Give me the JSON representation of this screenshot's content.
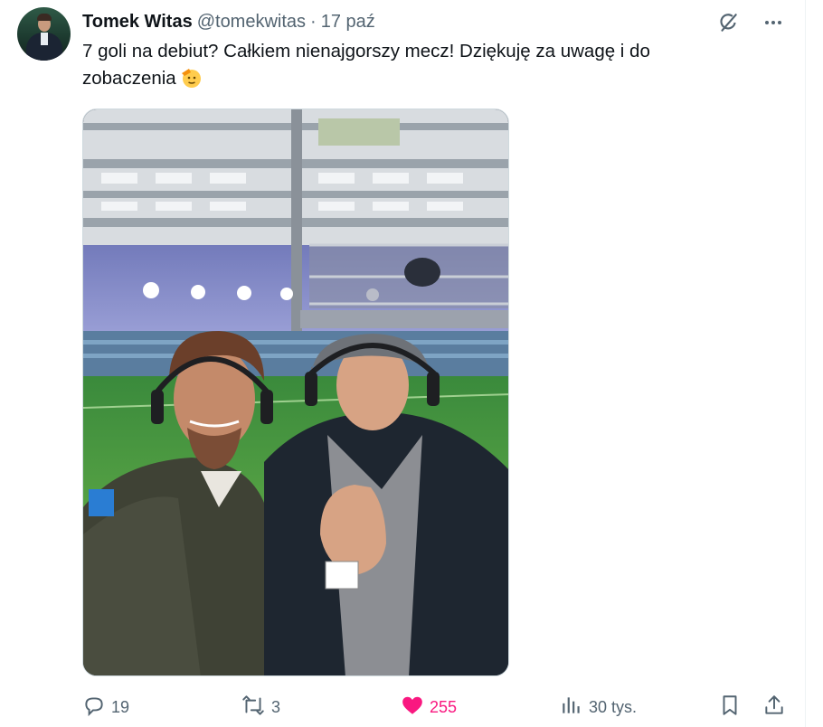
{
  "author": {
    "name": "Tomek Witas",
    "handle": "@tomekwitas",
    "separator": "·",
    "time": "17 paź"
  },
  "tweet": {
    "text_line1": "7 goli na debiut? Całkiem nienajgorszy mecz! Dziękuję za uwagę i do",
    "text_line2": "zobaczenia",
    "emoji": "saluting-face-emoji"
  },
  "actions": {
    "replies": "19",
    "reposts": "3",
    "likes": "255",
    "views": "30 tys."
  },
  "icons": {
    "grok": "grok-icon",
    "more": "more-icon",
    "reply": "reply-icon",
    "repost": "repost-icon",
    "like": "heart-filled-icon",
    "views": "views-chart-icon",
    "bookmark": "bookmark-icon",
    "share": "share-icon"
  },
  "colors": {
    "text": "#0f1419",
    "secondary": "#536471",
    "like": "#f91880",
    "border": "#cfd9de"
  }
}
